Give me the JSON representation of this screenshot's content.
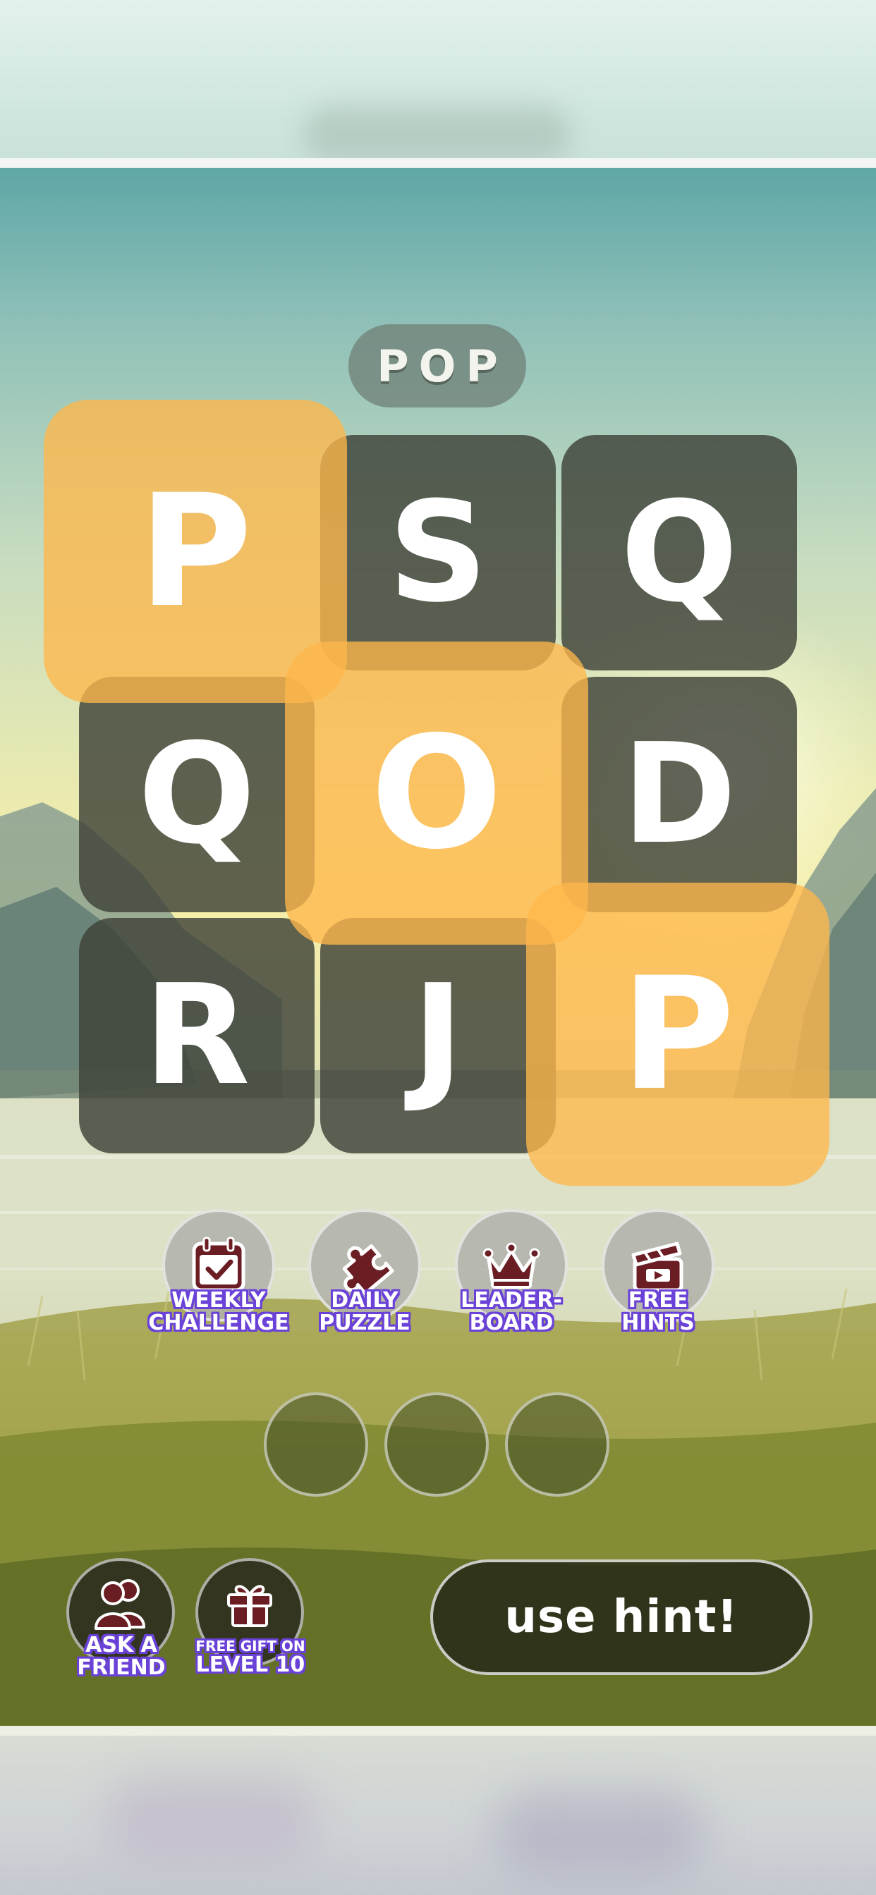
{
  "puzzle": {
    "target_word": "POP"
  },
  "grid": {
    "tiles": [
      {
        "letter": "P",
        "selected": true
      },
      {
        "letter": "S",
        "selected": false
      },
      {
        "letter": "Q",
        "selected": false
      },
      {
        "letter": "Q",
        "selected": false
      },
      {
        "letter": "O",
        "selected": true
      },
      {
        "letter": "D",
        "selected": false
      },
      {
        "letter": "R",
        "selected": false
      },
      {
        "letter": "J",
        "selected": false
      },
      {
        "letter": "P",
        "selected": true
      }
    ]
  },
  "features": [
    {
      "label": "WEEKLY\nCHALLENGE",
      "icon": "calendar-check-icon"
    },
    {
      "label": "DAILY\nPUZZLE",
      "icon": "puzzle-piece-icon"
    },
    {
      "label": "LEADER-\nBOARD",
      "icon": "crown-icon"
    },
    {
      "label": "FREE\nHINTS",
      "icon": "clapperboard-icon"
    }
  ],
  "answer_slots": 3,
  "bottom": {
    "ask_friend": {
      "line1": "ASK A",
      "line2": "FRIEND",
      "icon": "people-icon"
    },
    "free_gift": {
      "line1": "FREE GIFT ON",
      "line2": "LEVEL 10",
      "icon": "gift-icon"
    },
    "hint_label": "use hint!"
  },
  "colors": {
    "selected_tile": "#ffb74c",
    "dark_tile": "#3e4238",
    "label_outline": "#6a42d8",
    "icon_maroon": "#6b1d24"
  }
}
